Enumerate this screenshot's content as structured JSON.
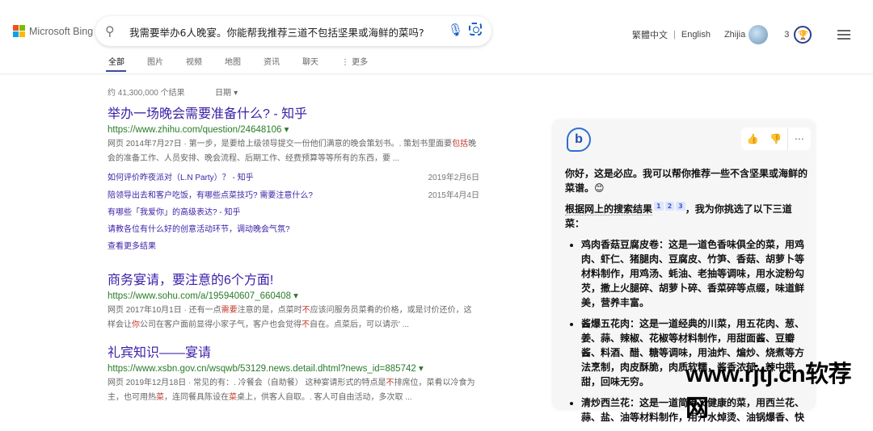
{
  "header": {
    "logo": "Microsoft Bing",
    "query": "我需要举办6人晚宴。你能帮我推荐三道不包括坚果或海鲜的菜吗?",
    "tabs": [
      "全部",
      "图片",
      "视频",
      "地图",
      "资讯",
      "聊天",
      "⋮ 更多"
    ],
    "lang_tc": "繁體中文",
    "sep": "|",
    "lang_en": "English",
    "user": "Zhijia",
    "points": "3"
  },
  "results_count": "约 41,300,000 个结果",
  "date_filter": "日期 ▾",
  "results": [
    {
      "title": "举办一场晚会需要准备什么? - 知乎",
      "url": "https://www.zhihu.com/question/24648106 ▾",
      "snippet": [
        {
          "t": "网页 2014年7月27日 · 第一步，是要给上级领导提交一份他们满意的晚会策划书。. 策划书里面要"
        },
        {
          "t": "包括",
          "hl": true
        },
        {
          "t": "晚会的准备工作、人员安排、晚会流程、后期工作、经费预算等等所有的东西，要 ..."
        }
      ]
    },
    {
      "title": "商务宴请，要注意的6个方面!",
      "url": "https://www.sohu.com/a/195940607_660408 ▾",
      "snippet": [
        {
          "t": "网页 2017年10月1日 · 还有一点"
        },
        {
          "t": "需要",
          "hl": true
        },
        {
          "t": "注意的是，点菜时"
        },
        {
          "t": "不",
          "hl": true
        },
        {
          "t": "应该问服务员菜肴的价格，或是讨价还价，这样会让"
        },
        {
          "t": "你",
          "hl": true
        },
        {
          "t": "公司在客户面前显得小家子气，客户也会觉得"
        },
        {
          "t": "不",
          "hl": true
        },
        {
          "t": "自在。点菜后，可以请示' ..."
        }
      ]
    },
    {
      "title": "礼宾知识——宴请",
      "url": "https://www.xsbn.gov.cn/wsqwb/53129.news.detail.dhtml?news_id=885742 ▾",
      "snippet": [
        {
          "t": "网页 2019年12月18日 · 常见的有：. 冷餐会（自助餐） 这种宴请形式的特点是"
        },
        {
          "t": "不",
          "hl": true
        },
        {
          "t": "排席位，菜肴以冷食为主，也可用热"
        },
        {
          "t": "菜",
          "hl": true
        },
        {
          "t": "，连同餐具陈设在"
        },
        {
          "t": "菜",
          "hl": true
        },
        {
          "t": "桌上，供客人自取。. 客人可自由活动，多次取 ..."
        }
      ]
    }
  ],
  "sublinks": [
    {
      "t": "如何评价昨夜派对（L.N Party）？ - 知乎",
      "d": "2019年2月6日"
    },
    {
      "t": "陪领导出去和客户吃饭，有哪些点菜技巧? 需要注意什么?",
      "d": "2015年4月4日"
    },
    {
      "t": "有哪些「我爱你」的高级表达? - 知乎",
      "d": ""
    },
    {
      "t": "请教各位有什么好的创意活动环节，调动晚会气氛?",
      "d": ""
    },
    {
      "t": "查看更多结果",
      "d": ""
    }
  ],
  "chat": {
    "greeting": "你好，这是必应。我可以帮你推荐一些不含坚果或海鲜的菜谱。😊",
    "intro_a": "根据网上的搜索结果",
    "cites": [
      "1",
      "2",
      "3"
    ],
    "intro_b": "，我为你挑选了以下三道菜：",
    "items": [
      "鸡肉香菇豆腐皮卷：这是一道色香味俱全的菜，用鸡肉、虾仁、猪腿肉、豆腐皮、竹笋、香菇、胡萝卜等材料制作，用鸡汤、蚝油、老抽等调味，用水淀粉勾芡，撒上火腿碎、胡萝卜碎、香菜碎等点缀，味道鲜美，营养丰富。",
      "酱爆五花肉：这是一道经典的川菜，用五花肉、葱、姜、蒜、辣椒、花椒等材料制作，用甜面酱、豆瓣酱、料酒、醋、糖等调味，用油炸、煸炒、烧煮等方法烹制，肉皮酥脆，肉质软糯，酱香浓郁，辣中带甜，回味无穷。",
      "清炒西兰花：这是一道简单又健康的菜，用西兰花、蒜、盐、油等材料制作，用开水焯烫、油锅爆香、快"
    ]
  },
  "watermark": "www.rjtj.cn软荐网"
}
